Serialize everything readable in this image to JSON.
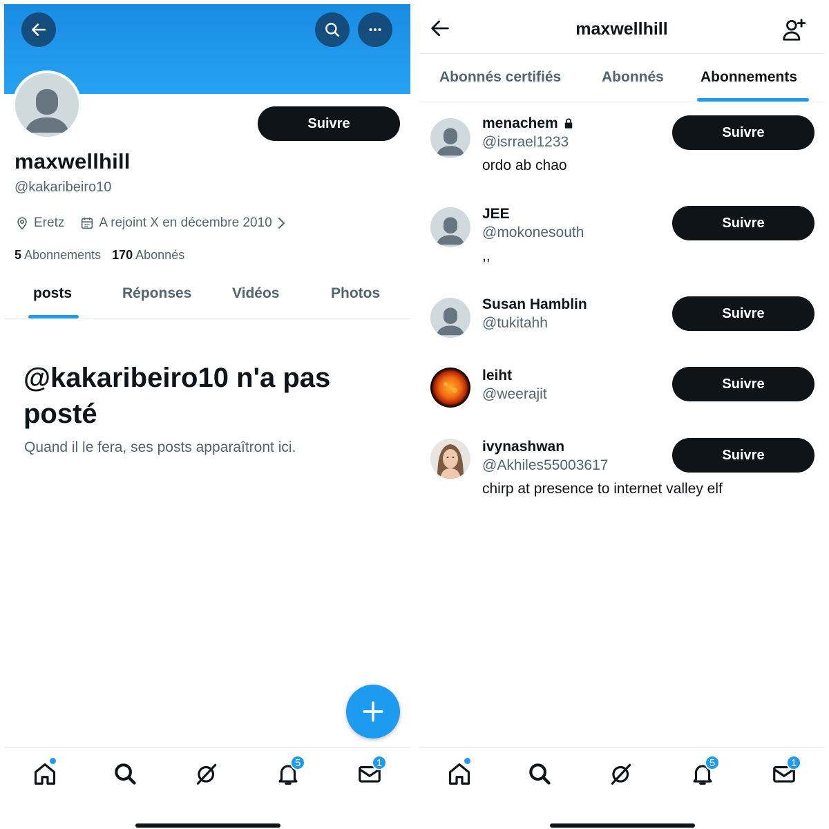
{
  "profile_screen": {
    "display_name": "maxwellhill",
    "handle": "@kakaribeiro10",
    "follow_label": "Suivre",
    "location": "Eretz",
    "joined": "A rejoint X en décembre 2010",
    "following_count": "5",
    "following_label": "Abonnements",
    "followers_count": "170",
    "followers_label": "Abonnés",
    "tabs": [
      {
        "label": "posts",
        "active": true
      },
      {
        "label": "Réponses",
        "active": false
      },
      {
        "label": "Vidéos",
        "active": false
      },
      {
        "label": "Photos",
        "active": false
      }
    ],
    "empty_title": "@kakaribeiro10 n'a pas posté",
    "empty_subtitle": "Quand il le fera, ses posts apparaîtront ici.",
    "banner_color": "#1d9bf0",
    "accent_color": "#1d9bf0"
  },
  "following_screen": {
    "title": "maxwellhill",
    "tabs": [
      {
        "label": "Abonnés certifiés",
        "active": false
      },
      {
        "label": "Abonnés",
        "active": false
      },
      {
        "label": "Abonnements",
        "active": true
      }
    ],
    "users": [
      {
        "name": "menachem",
        "handle": "@isrrael1233",
        "bio": "ordo ab chao",
        "protected": true,
        "avatar": "default-avatar",
        "follow_label": "Suivre"
      },
      {
        "name": "JEE",
        "handle": "@mokonesouth",
        "bio": ",,",
        "protected": false,
        "avatar": "default-avatar",
        "follow_label": "Suivre"
      },
      {
        "name": "Susan Hamblin",
        "handle": "@tukitahh",
        "bio": "",
        "protected": false,
        "avatar": "default-avatar",
        "follow_label": "Suivre"
      },
      {
        "name": "leiht",
        "handle": "@weerajit",
        "bio": "",
        "protected": false,
        "avatar": "sun-photo-avatar",
        "follow_label": "Suivre"
      },
      {
        "name": "ivynashwan",
        "handle": "@Akhiles55003617",
        "bio": "chirp at presence to internet valley elf",
        "protected": false,
        "avatar": "woman-photo-avatar",
        "follow_label": "Suivre"
      }
    ]
  },
  "bottom_nav": {
    "items": [
      {
        "icon": "home-icon",
        "indicator": "dot"
      },
      {
        "icon": "search-icon"
      },
      {
        "icon": "grok-icon"
      },
      {
        "icon": "bell-icon",
        "badge": "5"
      },
      {
        "icon": "mail-icon",
        "badge": "1"
      }
    ]
  },
  "icons": {
    "back": "arrow-left-icon",
    "search": "search-icon",
    "more": "more-horizontal-icon",
    "add_user": "add-user-icon",
    "location": "location-pin-icon",
    "calendar": "calendar-icon",
    "compose": "plus-icon",
    "lock": "lock-icon"
  }
}
